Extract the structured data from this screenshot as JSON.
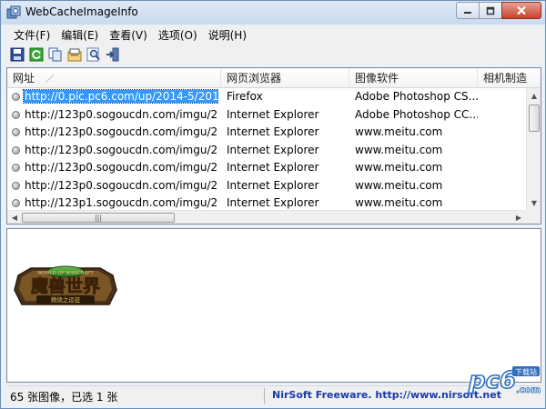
{
  "window": {
    "title": "WebCacheImageInfo"
  },
  "menu": [
    {
      "label": "文件(F)"
    },
    {
      "label": "编辑(E)"
    },
    {
      "label": "查看(V)"
    },
    {
      "label": "选项(O)"
    },
    {
      "label": "说明(H)"
    }
  ],
  "toolbar": [
    {
      "icon": "save-icon"
    },
    {
      "icon": "refresh-icon"
    },
    {
      "icon": "copy-icon"
    },
    {
      "icon": "properties-icon"
    },
    {
      "icon": "find-icon"
    },
    {
      "icon": "exit-icon"
    }
  ],
  "table": {
    "columns": [
      "网址",
      "网页浏览器",
      "图像软件",
      "相机制造"
    ],
    "rows": [
      {
        "url": "http://0.pic.pc6.com/up/2014-5/2014...",
        "browser": "Firefox",
        "software": "Adobe Photoshop CS...",
        "camera": "",
        "selected": true
      },
      {
        "url": "http://123p0.sogoucdn.com/imgu/20...",
        "browser": "Internet Explorer",
        "software": "Adobe Photoshop CC...",
        "camera": ""
      },
      {
        "url": "http://123p0.sogoucdn.com/imgu/20...",
        "browser": "Internet Explorer",
        "software": "www.meitu.com",
        "camera": ""
      },
      {
        "url": "http://123p0.sogoucdn.com/imgu/20...",
        "browser": "Internet Explorer",
        "software": "www.meitu.com",
        "camera": ""
      },
      {
        "url": "http://123p0.sogoucdn.com/imgu/20...",
        "browser": "Internet Explorer",
        "software": "www.meitu.com",
        "camera": ""
      },
      {
        "url": "http://123p0.sogoucdn.com/imgu/20...",
        "browser": "Internet Explorer",
        "software": "www.meitu.com",
        "camera": ""
      },
      {
        "url": "http://123p1.sogoucdn.com/imgu/20...",
        "browser": "Internet Explorer",
        "software": "www.meitu.com",
        "camera": ""
      }
    ]
  },
  "preview": {
    "logo_top": "WORLD OF WARCRAFT",
    "logo_main": "魔兽世界",
    "logo_sub": "燃烧之远征"
  },
  "status": {
    "count_text": "65 张图像，已选 1 张",
    "credit_text": "NirSoft Freeware.  http://www.nirsoft.net"
  },
  "watermark": {
    "brand": "pc6",
    "tag": "下载站",
    "domain": ".com"
  },
  "colors": {
    "selection": "#3399ff",
    "credit_link": "#1a3aa8",
    "watermark": "#2f6fc0"
  }
}
